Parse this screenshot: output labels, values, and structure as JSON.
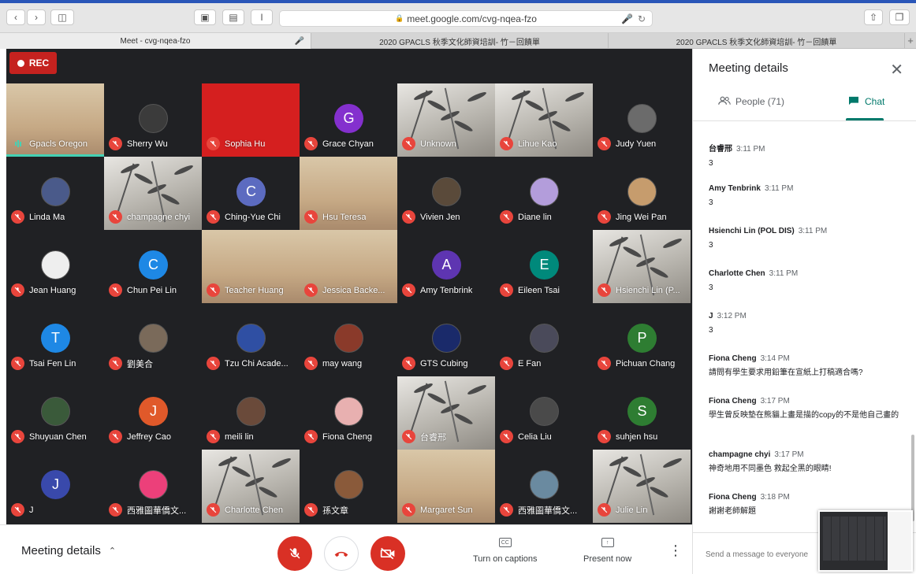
{
  "browser": {
    "url": "meet.google.com/cvg-nqea-fzo",
    "tabs": [
      {
        "title": "Meet - cvg-nqea-fzo",
        "active": true
      },
      {
        "title": "2020 GPACLS  秋季文化師資培訓- 竹－回饋單",
        "active": false
      },
      {
        "title": "2020 GPACLS  秋季文化師資培訓- 竹－回饋單",
        "active": false
      }
    ],
    "new_tab_label": "+"
  },
  "recording": {
    "label": "REC",
    "color": "#c5221f"
  },
  "participants": [
    {
      "name": "Gpacls Oregon",
      "kind": "video-face",
      "muted": false,
      "speaking": true
    },
    {
      "name": "Sherry Wu",
      "kind": "avatar",
      "avatar_color": "#3b3b3b",
      "avatar_text": "",
      "muted": true
    },
    {
      "name": "Sophia Hu",
      "kind": "red",
      "muted": true
    },
    {
      "name": "Grace Chyan",
      "kind": "avatar",
      "avatar_color": "#8430ce",
      "avatar_text": "G",
      "muted": true
    },
    {
      "name": "Unknown",
      "kind": "video",
      "muted": true
    },
    {
      "name": "Lihue Kao",
      "kind": "video",
      "muted": true
    },
    {
      "name": "Judy Yuen",
      "kind": "avatar",
      "avatar_color": "#6b6b6b",
      "avatar_text": "",
      "muted": true
    },
    {
      "name": "Linda Ma",
      "kind": "avatar",
      "avatar_color": "#4a5a8a",
      "avatar_text": "",
      "muted": true
    },
    {
      "name": "champagne chyi",
      "kind": "video",
      "muted": true
    },
    {
      "name": "Ching-Yue Chi",
      "kind": "avatar",
      "avatar_color": "#5c6bc0",
      "avatar_text": "C",
      "muted": true
    },
    {
      "name": "Hsu Teresa",
      "kind": "video-face",
      "muted": true
    },
    {
      "name": "Vivien Jen",
      "kind": "avatar",
      "avatar_color": "#5a4a3a",
      "avatar_text": "",
      "muted": true
    },
    {
      "name": "Diane lin",
      "kind": "avatar",
      "avatar_color": "#b39ddb",
      "avatar_text": "",
      "muted": true
    },
    {
      "name": "Jing Wei Pan",
      "kind": "avatar",
      "avatar_color": "#c69c6d",
      "avatar_text": "",
      "muted": true
    },
    {
      "name": "Jean Huang",
      "kind": "avatar",
      "avatar_color": "#eeeeee",
      "avatar_text": "",
      "muted": true
    },
    {
      "name": "Chun Pei Lin",
      "kind": "avatar",
      "avatar_color": "#1e88e5",
      "avatar_text": "C",
      "muted": true
    },
    {
      "name": "Teacher Huang",
      "kind": "video-face",
      "muted": true
    },
    {
      "name": "Jessica Backe...",
      "kind": "video-face",
      "muted": true
    },
    {
      "name": "Amy Tenbrink",
      "kind": "avatar",
      "avatar_color": "#5e35b1",
      "avatar_text": "A",
      "muted": true
    },
    {
      "name": "Eileen Tsai",
      "kind": "avatar",
      "avatar_color": "#00897b",
      "avatar_text": "E",
      "muted": true
    },
    {
      "name": "Hsienchi Lin (P...",
      "kind": "video",
      "muted": true
    },
    {
      "name": "Tsai Fen Lin",
      "kind": "avatar",
      "avatar_color": "#1e88e5",
      "avatar_text": "T",
      "muted": true
    },
    {
      "name": "劉美合",
      "kind": "avatar",
      "avatar_color": "#7a6a5a",
      "avatar_text": "",
      "muted": true
    },
    {
      "name": "Tzu Chi Acade...",
      "kind": "avatar",
      "avatar_color": "#2f4fa3",
      "avatar_text": "",
      "muted": true
    },
    {
      "name": "may wang",
      "kind": "avatar",
      "avatar_color": "#8a3a2a",
      "avatar_text": "",
      "muted": true
    },
    {
      "name": "GTS Cubing",
      "kind": "avatar",
      "avatar_color": "#1a2a6a",
      "avatar_text": "",
      "muted": true
    },
    {
      "name": "E Fan",
      "kind": "avatar",
      "avatar_color": "#4a4a5a",
      "avatar_text": "",
      "muted": true
    },
    {
      "name": "Pichuan Chang",
      "kind": "avatar",
      "avatar_color": "#2e7d32",
      "avatar_text": "P",
      "muted": true
    },
    {
      "name": "Shuyuan Chen",
      "kind": "avatar",
      "avatar_color": "#3a5a3a",
      "avatar_text": "",
      "muted": true
    },
    {
      "name": "Jeffrey Cao",
      "kind": "avatar",
      "avatar_color": "#e0592a",
      "avatar_text": "J",
      "muted": true
    },
    {
      "name": "meili lin",
      "kind": "avatar",
      "avatar_color": "#6a4a3a",
      "avatar_text": "",
      "muted": true
    },
    {
      "name": "Fiona Cheng",
      "kind": "avatar",
      "avatar_color": "#e8b0b0",
      "avatar_text": "",
      "muted": true
    },
    {
      "name": "台睿邢",
      "kind": "video",
      "muted": true
    },
    {
      "name": "Celia Liu",
      "kind": "avatar",
      "avatar_color": "#4a4a4a",
      "avatar_text": "",
      "muted": true
    },
    {
      "name": "suhjen hsu",
      "kind": "avatar",
      "avatar_color": "#2e7d32",
      "avatar_text": "S",
      "muted": true
    },
    {
      "name": "J",
      "kind": "avatar",
      "avatar_color": "#3949ab",
      "avatar_text": "J",
      "muted": true
    },
    {
      "name": "西雅圖華僑文...",
      "kind": "avatar",
      "avatar_color": "#ec407a",
      "avatar_text": "",
      "muted": true
    },
    {
      "name": "Charlotte Chen",
      "kind": "video",
      "muted": true
    },
    {
      "name": "孫文章",
      "kind": "avatar",
      "avatar_color": "#8a5a3a",
      "avatar_text": "",
      "muted": true
    },
    {
      "name": "Margaret Sun",
      "kind": "video-face",
      "muted": true
    },
    {
      "name": "西雅圖華僑文...",
      "kind": "avatar",
      "avatar_color": "#6a8aa0",
      "avatar_text": "",
      "muted": true
    },
    {
      "name": "Julie Lin",
      "kind": "video",
      "muted": true
    }
  ],
  "controls": {
    "meeting_details": "Meeting details",
    "captions": "Turn on captions",
    "captions_icon": "CC",
    "present": "Present now"
  },
  "panel": {
    "title": "Meeting details",
    "people_tab": "People (71)",
    "chat_tab": "Chat",
    "input_placeholder": "Send a message to everyone",
    "messages": [
      {
        "sender": "台睿邢",
        "time": "3:11 PM",
        "text": "3"
      },
      {
        "sender": "Amy Tenbrink",
        "time": "3:11 PM",
        "text": "3"
      },
      {
        "sender": "Hsienchi Lin (POL DIS)",
        "time": "3:11 PM",
        "text": "3"
      },
      {
        "sender": "Charlotte Chen",
        "time": "3:11 PM",
        "text": "3"
      },
      {
        "sender": "J",
        "time": "3:12 PM",
        "text": "3"
      },
      {
        "sender": "Fiona Cheng",
        "time": "3:14 PM",
        "text": "請問有學生要求用鉛筆在宣紙上打稿適合嗎?"
      },
      {
        "sender": "Fiona Cheng",
        "time": "3:17 PM",
        "text": "學生曾反映墊在熊貓上畫是描的copy的不是他自己畫的"
      },
      {
        "sender": "champagne chyi",
        "time": "3:17 PM",
        "text": "神奇地用不同墨色 救起全黑的眼睛!"
      },
      {
        "sender": "Fiona Cheng",
        "time": "3:18 PM",
        "text": "謝謝老師解題"
      }
    ]
  }
}
